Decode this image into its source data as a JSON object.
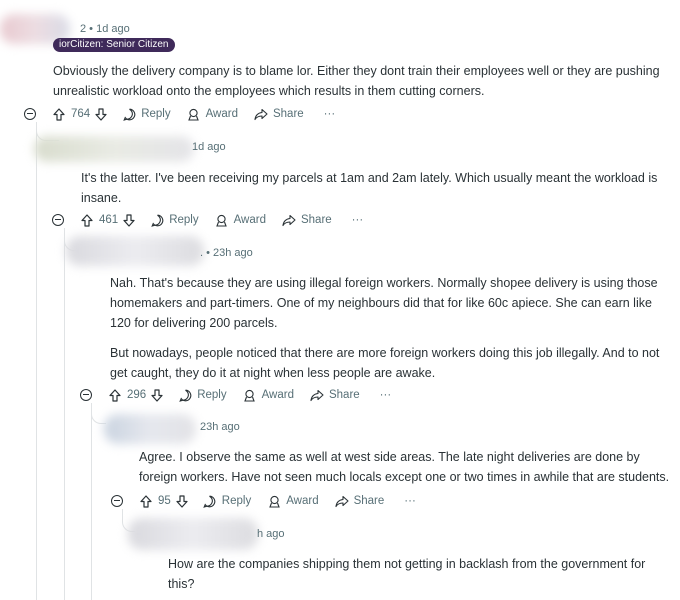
{
  "comments": [
    {
      "meta": "2 • 1d ago",
      "flair": "iorCitizen: Senior Citizen",
      "body": [
        "Obviously the delivery company is to blame lor. Either they dont train their employees well or they are pushing unrealistic workload onto the employees which results in them cutting corners."
      ],
      "votes": "764"
    },
    {
      "meta": "1d ago",
      "body": [
        "It's the latter. I've been receiving my parcels at 1am and 2am lately. Which usually meant the workload is insane."
      ],
      "votes": "461"
    },
    {
      "meta": ". • 23h ago",
      "body": [
        "Nah. That's because they are using illegal foreign workers. Normally shopee delivery is using those homemakers and part-timers. One of my neighbours did that for like 60c apiece. She can earn like 120 for delivering 200 parcels.",
        "But nowadays, people noticed that there are more foreign workers doing this job illegally. And to not get caught, they do it at night when less people are awake."
      ],
      "votes": "296"
    },
    {
      "meta": "23h ago",
      "body": [
        "Agree. I observe the same as well at west side areas. The late night deliveries are done by foreign workers. Have not seen much locals except one or two times in awhile that are students."
      ],
      "votes": "95"
    },
    {
      "meta": "h ago",
      "body": [
        "How are the companies shipping them not getting in backlash from the government for this?"
      ]
    }
  ],
  "actions": {
    "reply": "Reply",
    "award": "Award",
    "share": "Share",
    "more": "···"
  },
  "icons": [
    "upvote-icon",
    "downvote-icon",
    "reply-icon",
    "award-icon",
    "share-icon",
    "collapse-icon"
  ]
}
